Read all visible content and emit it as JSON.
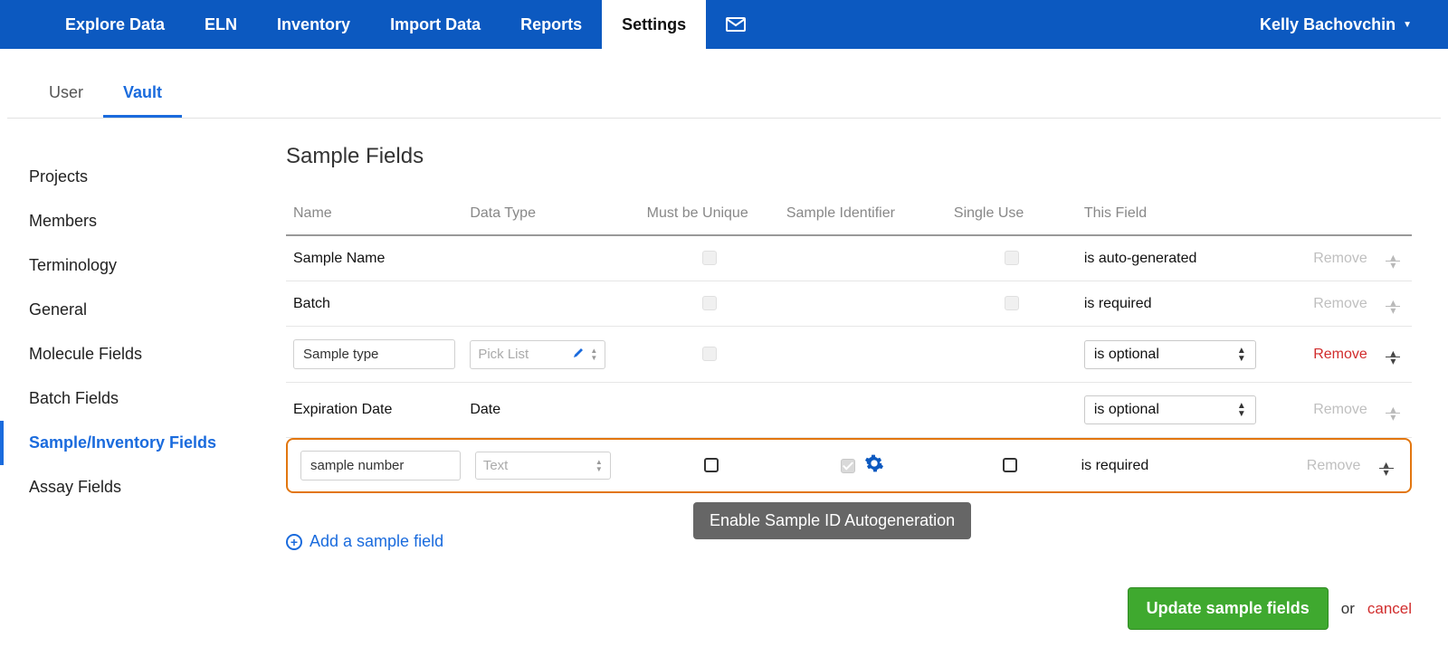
{
  "nav": {
    "items": [
      {
        "label": "Explore Data"
      },
      {
        "label": "ELN"
      },
      {
        "label": "Inventory"
      },
      {
        "label": "Import Data"
      },
      {
        "label": "Reports"
      },
      {
        "label": "Settings",
        "active": true
      }
    ],
    "user_name": "Kelly Bachovchin"
  },
  "subtabs": {
    "items": [
      {
        "label": "User"
      },
      {
        "label": "Vault",
        "active": true
      }
    ]
  },
  "sidebar": {
    "items": [
      {
        "label": "Projects"
      },
      {
        "label": "Members"
      },
      {
        "label": "Terminology"
      },
      {
        "label": "General"
      },
      {
        "label": "Molecule Fields"
      },
      {
        "label": "Batch Fields"
      },
      {
        "label": "Sample/Inventory Fields",
        "active": true
      },
      {
        "label": "Assay Fields"
      }
    ]
  },
  "page": {
    "title": "Sample Fields"
  },
  "table": {
    "headers": {
      "name": "Name",
      "data_type": "Data Type",
      "must_unique": "Must be Unique",
      "sample_ident": "Sample Identifier",
      "single_use": "Single Use",
      "this_field": "This Field"
    },
    "rows": [
      {
        "name": "Sample Name",
        "data_type": "",
        "this_field_text": "is auto-generated",
        "remove_enabled": false,
        "unique_disabled": true,
        "single_disabled": true
      },
      {
        "name": "Batch",
        "data_type": "",
        "this_field_text": "is required",
        "remove_enabled": false,
        "unique_disabled": true,
        "single_disabled": true
      },
      {
        "name_input": "Sample type",
        "data_type_input": "Pick List",
        "this_field_select": "is optional",
        "remove_enabled": true,
        "unique_disabled": true
      },
      {
        "name": "Expiration Date",
        "data_type": "Date",
        "this_field_select": "is optional",
        "remove_enabled": false
      },
      {
        "name_input": "sample number",
        "data_type_input": "Text",
        "this_field_text": "is required",
        "remove_enabled": false,
        "highlighted": true,
        "ident_checked": true,
        "show_gear": true
      }
    ],
    "remove_label": "Remove"
  },
  "tooltip": {
    "text": "Enable Sample ID Autogeneration"
  },
  "add_link": {
    "label": "Add a sample field"
  },
  "footer": {
    "update_btn": "Update sample fields",
    "or": "or",
    "cancel": "cancel"
  }
}
